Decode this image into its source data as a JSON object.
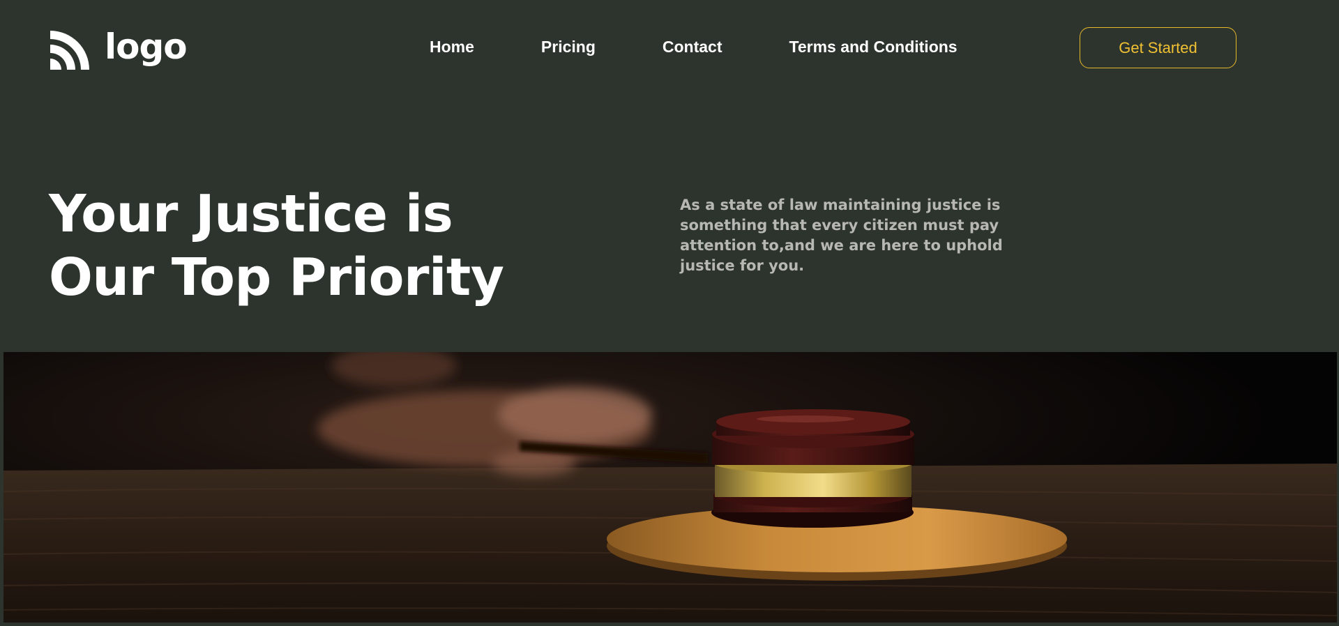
{
  "header": {
    "logo_text": "logo",
    "logo_icon": "wifi-arcs-icon",
    "nav": [
      {
        "label": "Home"
      },
      {
        "label": "Pricing"
      },
      {
        "label": "Contact"
      },
      {
        "label": "Terms and Conditions"
      }
    ],
    "cta_label": "Get Started"
  },
  "hero": {
    "title_line1": "Your Justice is",
    "title_line2": "Our Top Priority",
    "description": "As a state of law maintaining justice is something that every citizen must pay attention to,and we are here to uphold justice for you."
  },
  "image": {
    "subject": "gavel-photo"
  },
  "colors": {
    "background": "#2d342d",
    "accent": "#e7b82a",
    "text_primary": "#ffffff",
    "text_secondary": "#b8b8b3"
  }
}
